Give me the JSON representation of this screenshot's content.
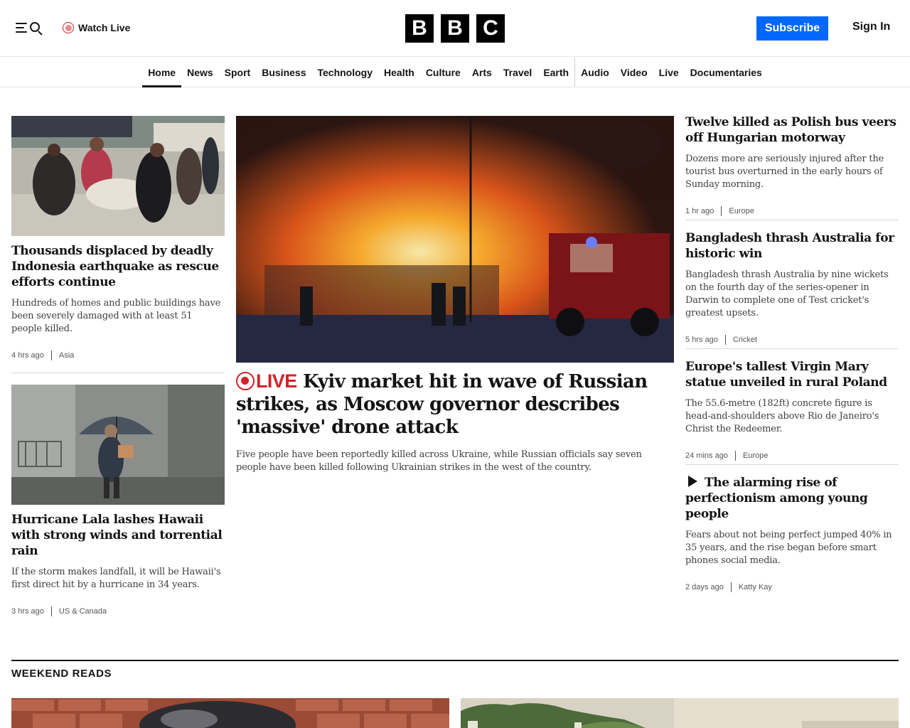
{
  "masthead": {
    "watch_live": "Watch Live",
    "logo_letters": [
      "B",
      "B",
      "C"
    ],
    "subscribe": "Subscribe",
    "sign_in": "Sign In"
  },
  "nav": {
    "items": [
      "Home",
      "News",
      "Sport",
      "Business",
      "Technology",
      "Health",
      "Culture",
      "Arts",
      "Travel",
      "Earth",
      "Audio",
      "Video",
      "Live",
      "Documentaries"
    ],
    "active": "Home"
  },
  "left_stories": [
    {
      "headline": "Thousands displaced by deadly Indonesia earthquake as rescue efforts continue",
      "summary": "Hundreds of homes and public buildings have been severely damaged with at least 51 people killed.",
      "time": "4 hrs ago",
      "tag": "Asia"
    },
    {
      "headline": "Hurricane Lala lashes Hawaii with strong winds and torrential rain",
      "summary": "If the storm makes landfall, it will be Hawaii's first direct hit by a hurricane in 34 years.",
      "time": "3 hrs ago",
      "tag": "US & Canada"
    }
  ],
  "main_story": {
    "live_label": "LIVE",
    "headline": "Kyiv market hit in wave of Russian strikes, as Moscow governor describes 'massive' drone attack",
    "summary": "Five people have been reportedly killed across Ukraine, while Russian officials say seven people have been killed following Ukrainian strikes in the west of the country."
  },
  "right_stories": [
    {
      "headline": "Twelve killed as Polish bus veers off Hungarian motorway",
      "summary": "Dozens more are seriously injured after the tourist bus overturned in the early hours of Sunday morning.",
      "time": "1 hr ago",
      "tag": "Europe"
    },
    {
      "headline": "Bangladesh thrash Australia for historic win",
      "summary": "Bangladesh thrash Australia by nine wickets on the fourth day of the series-opener in Darwin to complete one of Test cricket's greatest upsets.",
      "time": "5 hrs ago",
      "tag": "Cricket"
    },
    {
      "headline": "Europe's tallest Virgin Mary statue unveiled in rural Poland",
      "summary": "The 55.6-metre (182ft) concrete figure is head-and-shoulders above Rio de Janeiro's Christ the Redeemer.",
      "time": "24 mins ago",
      "tag": "Europe"
    },
    {
      "headline": "The alarming rise of perfectionism among young people",
      "summary": "Fears about not being perfect jumped 40% in 35 years, and the rise began before smart phones social media.",
      "time": "2 days ago",
      "tag": "Katty Kay",
      "icon": "play-icon"
    }
  ],
  "section": {
    "title": "WEEKEND READS"
  },
  "colors": {
    "brand_black": "#000000",
    "subscribe_blue": "#0068ff",
    "live_red": "#d2232a"
  }
}
